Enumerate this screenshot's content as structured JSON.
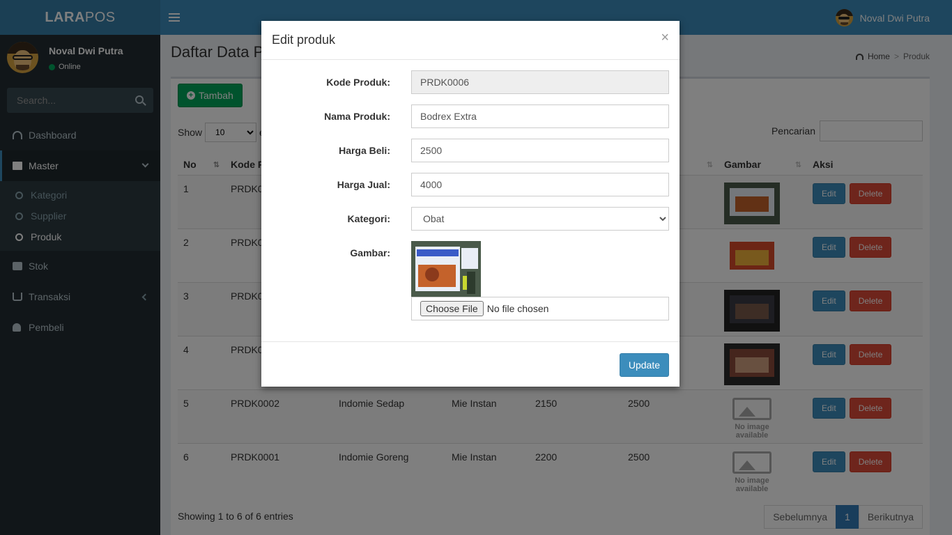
{
  "app": {
    "logo_bold": "LARA",
    "logo_light": "POS"
  },
  "header": {
    "user_name": "Noval Dwi Putra"
  },
  "sidebar": {
    "user_name": "Noval Dwi Putra",
    "status": "Online",
    "search_placeholder": "Search...",
    "items": {
      "dashboard": "Dashboard",
      "master": "Master",
      "kategori": "Kategori",
      "supplier": "Supplier",
      "produk": "Produk",
      "stok": "Stok",
      "transaksi": "Transaksi",
      "pembeli": "Pembeli"
    }
  },
  "content": {
    "title": "Daftar Data P",
    "breadcrumb": {
      "home": "Home",
      "current": "Produk"
    },
    "add_button": "Tambah",
    "show_label": "Show",
    "show_value": "10",
    "show_suffix": "e",
    "search_label": "Pencarian",
    "columns": {
      "no": "No",
      "kode": "Kode P",
      "gambar": "Gambar",
      "aksi": "Aksi"
    },
    "rows": [
      {
        "no": "1",
        "kode": "PRDK00",
        "nama": "",
        "kategori": "",
        "beli": "",
        "jual": "",
        "image": "photo"
      },
      {
        "no": "2",
        "kode": "PRDK00",
        "nama": "",
        "kategori": "",
        "beli": "",
        "jual": "",
        "image": "photo"
      },
      {
        "no": "3",
        "kode": "PRDK00",
        "nama": "",
        "kategori": "",
        "beli": "",
        "jual": "",
        "image": "photo"
      },
      {
        "no": "4",
        "kode": "PRDK00",
        "nama": "",
        "kategori": "",
        "beli": "",
        "jual": "",
        "image": "photo"
      },
      {
        "no": "5",
        "kode": "PRDK0002",
        "nama": "Indomie Sedap",
        "kategori": "Mie Instan",
        "beli": "2150",
        "jual": "2500",
        "image": "none"
      },
      {
        "no": "6",
        "kode": "PRDK0001",
        "nama": "Indomie Goreng",
        "kategori": "Mie Instan",
        "beli": "2200",
        "jual": "2500",
        "image": "none"
      }
    ],
    "edit_label": "Edit",
    "delete_label": "Delete",
    "no_image_line1": "No image",
    "no_image_line2": "available",
    "info": "Showing 1 to 6 of 6 entries",
    "pagination": {
      "prev": "Sebelumnya",
      "current": "1",
      "next": "Berikutnya"
    }
  },
  "modal": {
    "title": "Edit produk",
    "close": "×",
    "fields": {
      "kode_label": "Kode Produk:",
      "kode_value": "PRDK0006",
      "nama_label": "Nama Produk:",
      "nama_value": "Bodrex Extra",
      "beli_label": "Harga Beli:",
      "beli_value": "2500",
      "jual_label": "Harga Jual:",
      "jual_value": "4000",
      "kategori_label": "Kategori:",
      "kategori_value": "Obat",
      "gambar_label": "Gambar:"
    },
    "file_button": "Choose File",
    "file_status": "No file chosen",
    "update_button": "Update"
  }
}
